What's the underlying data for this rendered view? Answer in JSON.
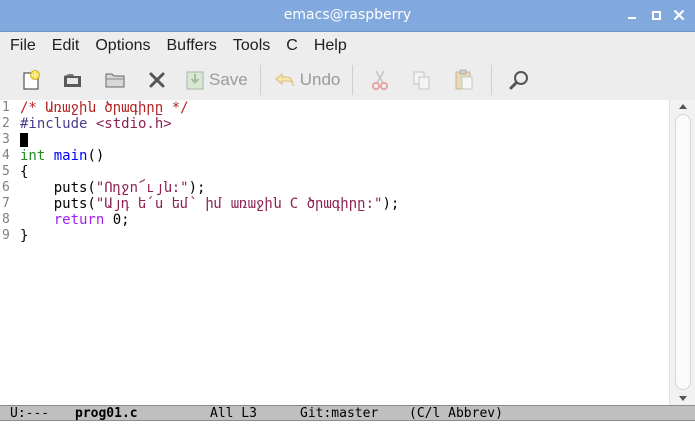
{
  "window": {
    "title": "emacs@raspberry"
  },
  "menubar": {
    "items": [
      "File",
      "Edit",
      "Options",
      "Buffers",
      "Tools",
      "C",
      "Help"
    ]
  },
  "toolbar": {
    "new_icon": "new-file-icon",
    "open_icon": "open-file-icon",
    "dired_icon": "open-directory-icon",
    "close_icon": "close-buffer-icon",
    "save_label": "Save",
    "undo_label": "Undo",
    "cut_icon": "scissors-icon",
    "copy_icon": "copy-icon",
    "paste_icon": "paste-icon",
    "search_icon": "search-icon"
  },
  "editor": {
    "line_numbers": [
      "1",
      "2",
      "3",
      "4",
      "5",
      "6",
      "7",
      "8",
      "9"
    ],
    "lines": {
      "l1": "/* Առաջին ծրագիրը */",
      "l2_pre": "#include ",
      "l2_hdr": "<stdio.h>",
      "l4_type": "int",
      "l4_func": "main",
      "l4_rest": "()",
      "l5": "{",
      "l6_a": "    puts(",
      "l6_str": "\"Ողջո՜ւյն:\"",
      "l6_b": ");",
      "l7_a": "    puts(",
      "l7_str": "\"Այդ ե՛ս եմ՝ իմ առաջին C ծրագիրը:\"",
      "l7_b": ");",
      "l8_kw": "return",
      "l8_rest": " 0;",
      "l9": "}"
    }
  },
  "modeline": {
    "status": "U:---",
    "buffer": "prog01.c",
    "position": "All L3",
    "vc": "Git:master",
    "modes": "(C/l Abbrev)"
  },
  "colors": {
    "titlebar": "#82a9dd",
    "comment": "#b22222",
    "preprocessor": "#483d8b",
    "string": "#8b2252",
    "type": "#228b22",
    "function": "#0000ff",
    "keyword": "#a020f0"
  }
}
